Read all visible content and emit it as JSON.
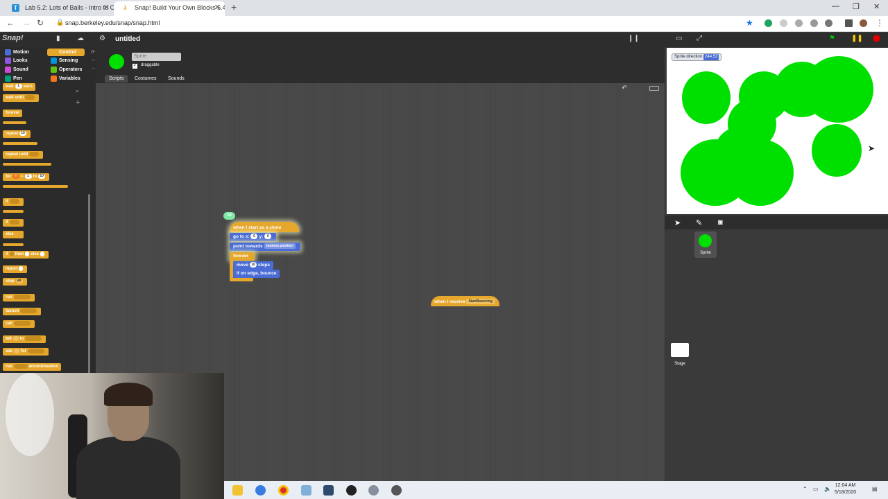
{
  "browser": {
    "tabs": [
      {
        "title": "Lab 5.2: Lots of Balls - Intro to Co",
        "favicon": "T",
        "favicon_color": "#2a8fd6"
      },
      {
        "title": "Snap! Build Your Own Blocks 5.4",
        "favicon": "λ",
        "favicon_color": "#e6a82c"
      }
    ],
    "new_tab": "+",
    "url": "snap.berkeley.edu/snap/snap.html"
  },
  "snap": {
    "logo": "Snap!",
    "project_title": "untitled",
    "categories": [
      {
        "label": "Motion",
        "color": "#4a6cd4"
      },
      {
        "label": "Control",
        "color": "#e6a82c"
      },
      {
        "label": "Looks",
        "color": "#8f56e3"
      },
      {
        "label": "Sensing",
        "color": "#0494dc"
      },
      {
        "label": "Sound",
        "color": "#cf4ad9"
      },
      {
        "label": "Operators",
        "color": "#62c213"
      },
      {
        "label": "Pen",
        "color": "#00a178"
      },
      {
        "label": "Variables",
        "color": "#f3761d"
      }
    ],
    "palette_blocks": {
      "wait_secs": "wait",
      "wait_secs_val": "1",
      "wait_secs_unit": "secs",
      "wait_until": "wait until",
      "forever": "forever",
      "repeat": "repeat",
      "repeat_val": "10",
      "repeat_until": "repeat until",
      "for": "for",
      "for_var": "i",
      "for_eq": "=",
      "for_from": "1",
      "for_to": "to",
      "for_to_val": "10",
      "if": "if",
      "if_else_if": "if",
      "else": "else",
      "if_then_else": "if",
      "then": "then",
      "else2": "else",
      "report": "report",
      "stop": "stop",
      "stop_val": "all",
      "run": "run",
      "launch": "launch",
      "call": "call",
      "tell": "tell",
      "tell_to": "to",
      "ask": "ask",
      "ask_for": "for",
      "run_cont": "run",
      "w_continuation": "w/continuation"
    },
    "sprite": {
      "name": "Sprite",
      "draggable_label": "draggable",
      "draggable_checked": "✓",
      "color": "#00e000"
    },
    "tabs": {
      "scripts": "Scripts",
      "costumes": "Costumes",
      "sounds": "Sounds"
    },
    "clone_badge": "16",
    "script1": {
      "hat": "when I start as a clone",
      "goto": "go to x:",
      "goto_x": "0",
      "goto_y_label": "y:",
      "goto_y": "0",
      "point": "point towards",
      "point_target": "random position",
      "forever": "forever",
      "move": "move",
      "move_val": "10",
      "move_unit": "steps",
      "bounce": "if on edge, bounce"
    },
    "script2": {
      "hat": "when I receive",
      "message": "StartBouncing"
    },
    "watcher": {
      "label": "Sprite direction",
      "value": "244.53"
    },
    "corral": {
      "sprite_label": "Sprite",
      "stage_label": "Stage"
    }
  },
  "taskbar": {
    "time": "12:04 AM",
    "date": "5/18/2020"
  }
}
